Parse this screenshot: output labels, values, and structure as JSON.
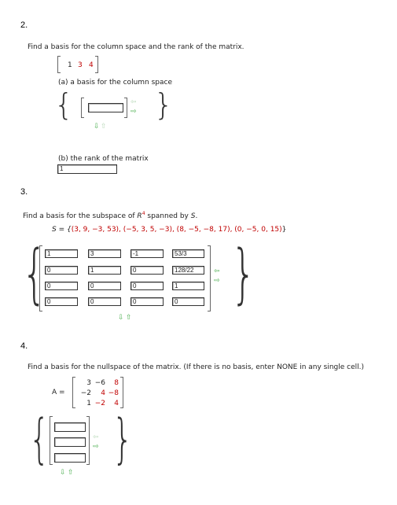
{
  "q2": {
    "number": "2.",
    "prompt": "Find a basis for the column space and the rank of the matrix.",
    "matrix": [
      "1",
      "3",
      "4"
    ],
    "part_a": "(a) a basis for the column space",
    "part_a_value": "",
    "part_b": "(b) the rank of the matrix",
    "rank_value": "1"
  },
  "q3": {
    "number": "3.",
    "prompt_prefix": "Find a basis for the subspace of ",
    "prompt_R": "R",
    "prompt_sup": "4",
    "prompt_suffix": " spanned by ",
    "prompt_S": "S",
    "prompt_end": ".",
    "set_label": "S = {",
    "set_vectors": "(3, 9, −3, 53), (−5, 3, 5, −3), (8, −5, −8, 17), (0, −5, 0, 15)",
    "set_close": "}",
    "cells": [
      [
        "1",
        "3",
        "-1",
        "53/3"
      ],
      [
        "0",
        "1",
        "0",
        "128/22"
      ],
      [
        "0",
        "0",
        "0",
        "1"
      ],
      [
        "0",
        "0",
        "0",
        "0"
      ]
    ]
  },
  "q4": {
    "number": "4.",
    "prompt": "Find a basis for the nullspace of the matrix. (If there is no basis, enter NONE in any single cell.)",
    "matrix_label": "A =",
    "matrix": [
      [
        "3",
        "−6",
        "8"
      ],
      [
        "−2",
        "4",
        "−8"
      ],
      [
        "1",
        "−2",
        "4"
      ]
    ],
    "cells": [
      "",
      "",
      ""
    ]
  },
  "icons": {
    "arrow_left": "⇦",
    "arrow_right": "⇨",
    "arrow_down": "⇩",
    "arrow_up": "⇧"
  },
  "colors": {
    "value_red": "#c00000",
    "arrow_green": "#4caf50",
    "arrow_disabled": "#b9d9b9"
  }
}
